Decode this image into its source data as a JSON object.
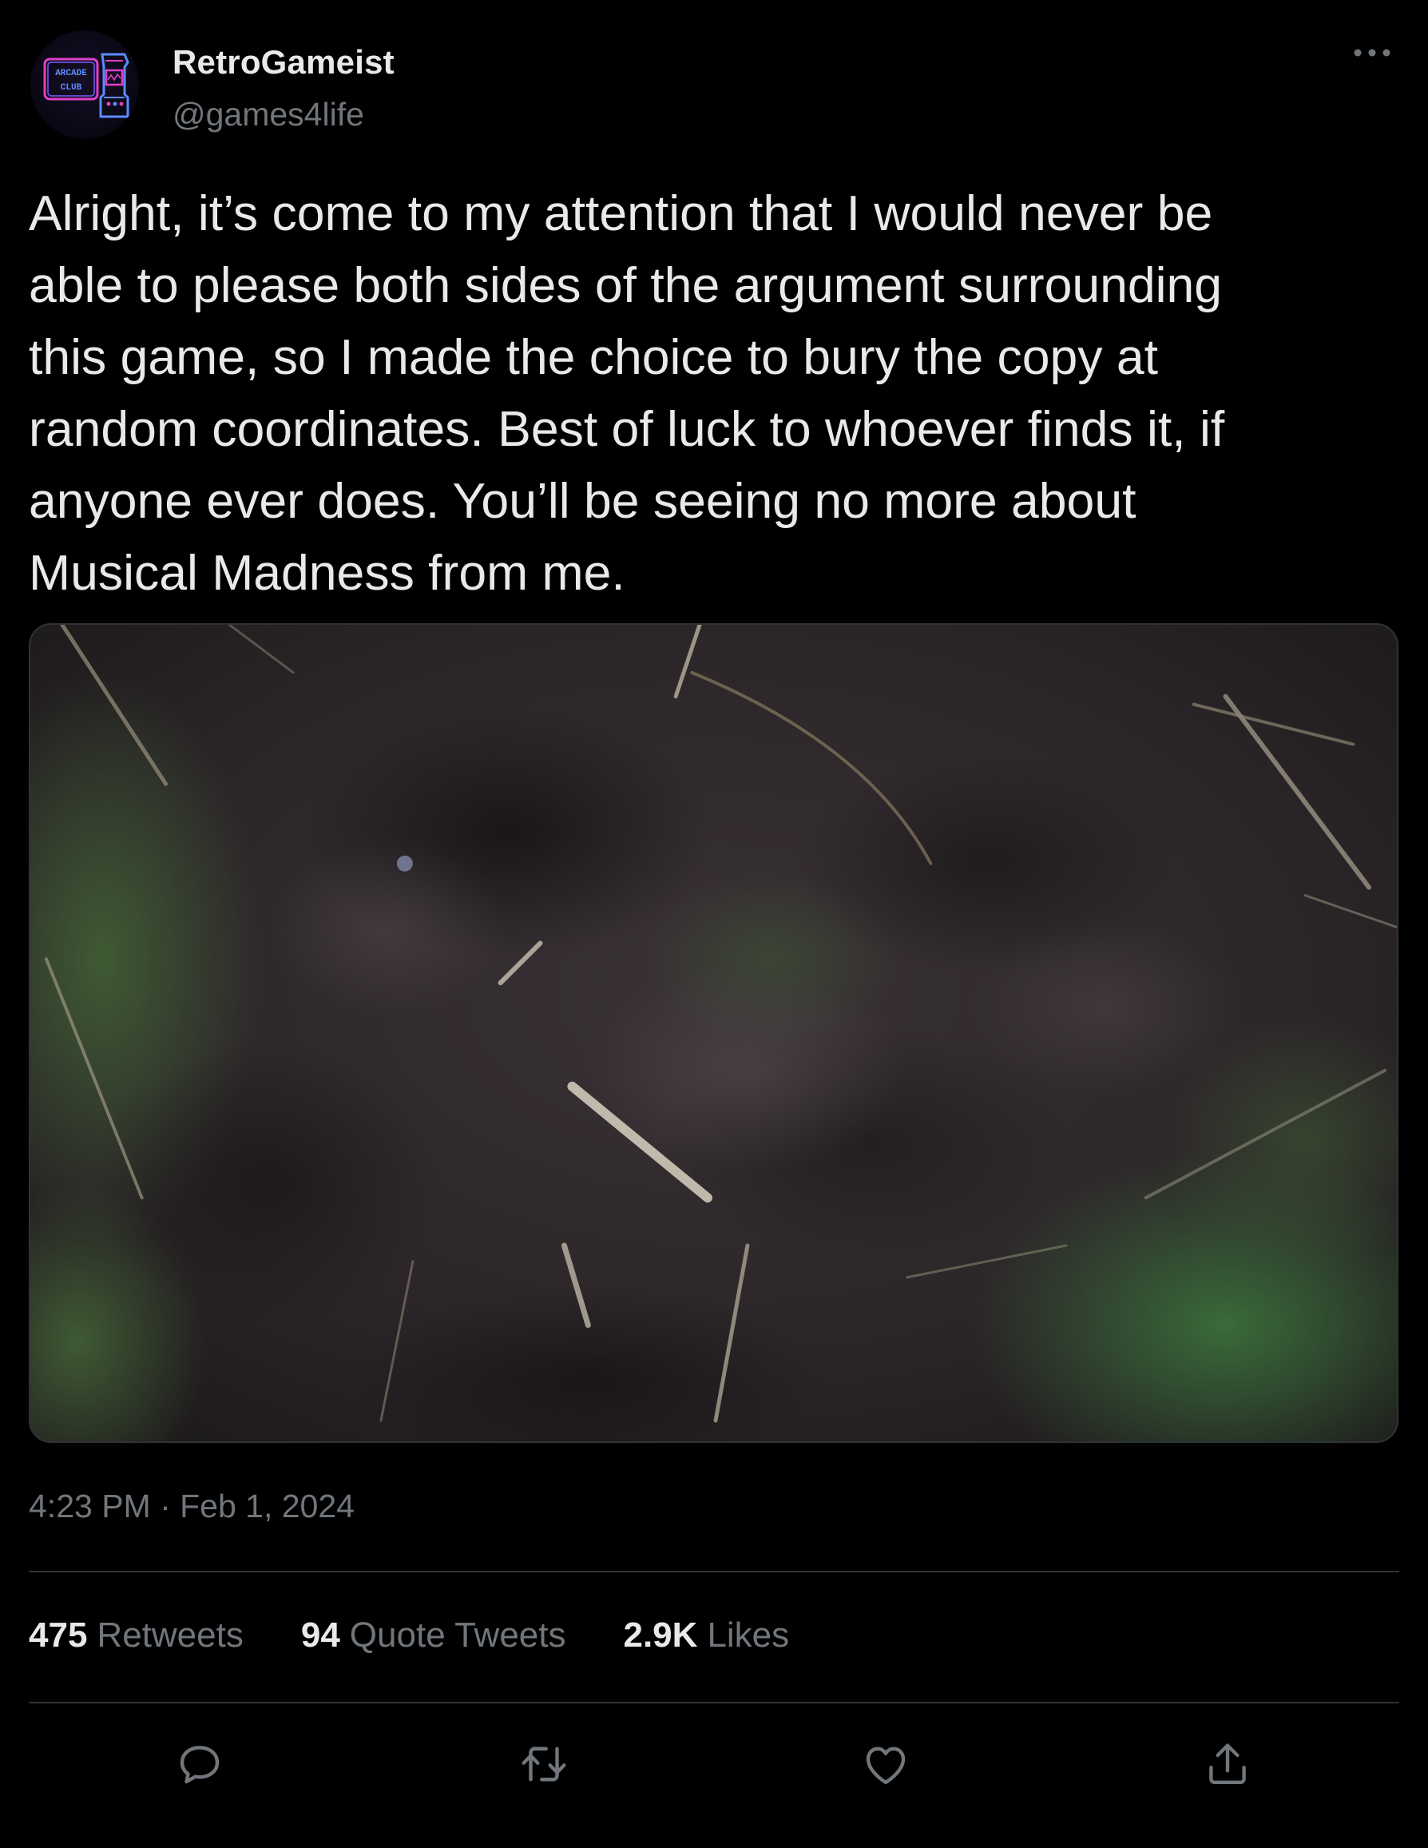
{
  "user": {
    "display_name": "RetroGameist",
    "handle": "@games4life",
    "avatar_text_line1": "ARCADE",
    "avatar_text_line2": "CLUB",
    "avatar_icon": "arcade-cabinet-icon"
  },
  "tweet": {
    "text": "Alright, it’s come to my attention that I would never be\nable to please both sides of the argument surrounding\nthis game, so I made the choice to bury the copy at\nrandom coordinates. Best of luck to whoever finds it, if\nanyone ever does. You’ll be seeing no more about\nMusical Madness from me.",
    "timestamp": "4:23 PM · Feb 1, 2024"
  },
  "stats": {
    "retweets_count": "475",
    "retweets_label": "Retweets",
    "quotes_count": "94",
    "quotes_label": "Quote Tweets",
    "likes_count": "2.9K",
    "likes_label": "Likes"
  },
  "icons": {
    "more": "more-horizontal-icon",
    "reply": "reply-icon",
    "retweet": "retweet-icon",
    "like": "heart-icon",
    "share": "share-icon"
  },
  "colors": {
    "background": "#000000",
    "text_primary": "#e7e9ea",
    "text_secondary": "#71767b",
    "divider": "#2f3336",
    "avatar_neon_pink": "#e040c8",
    "avatar_neon_blue": "#5b8cff"
  }
}
